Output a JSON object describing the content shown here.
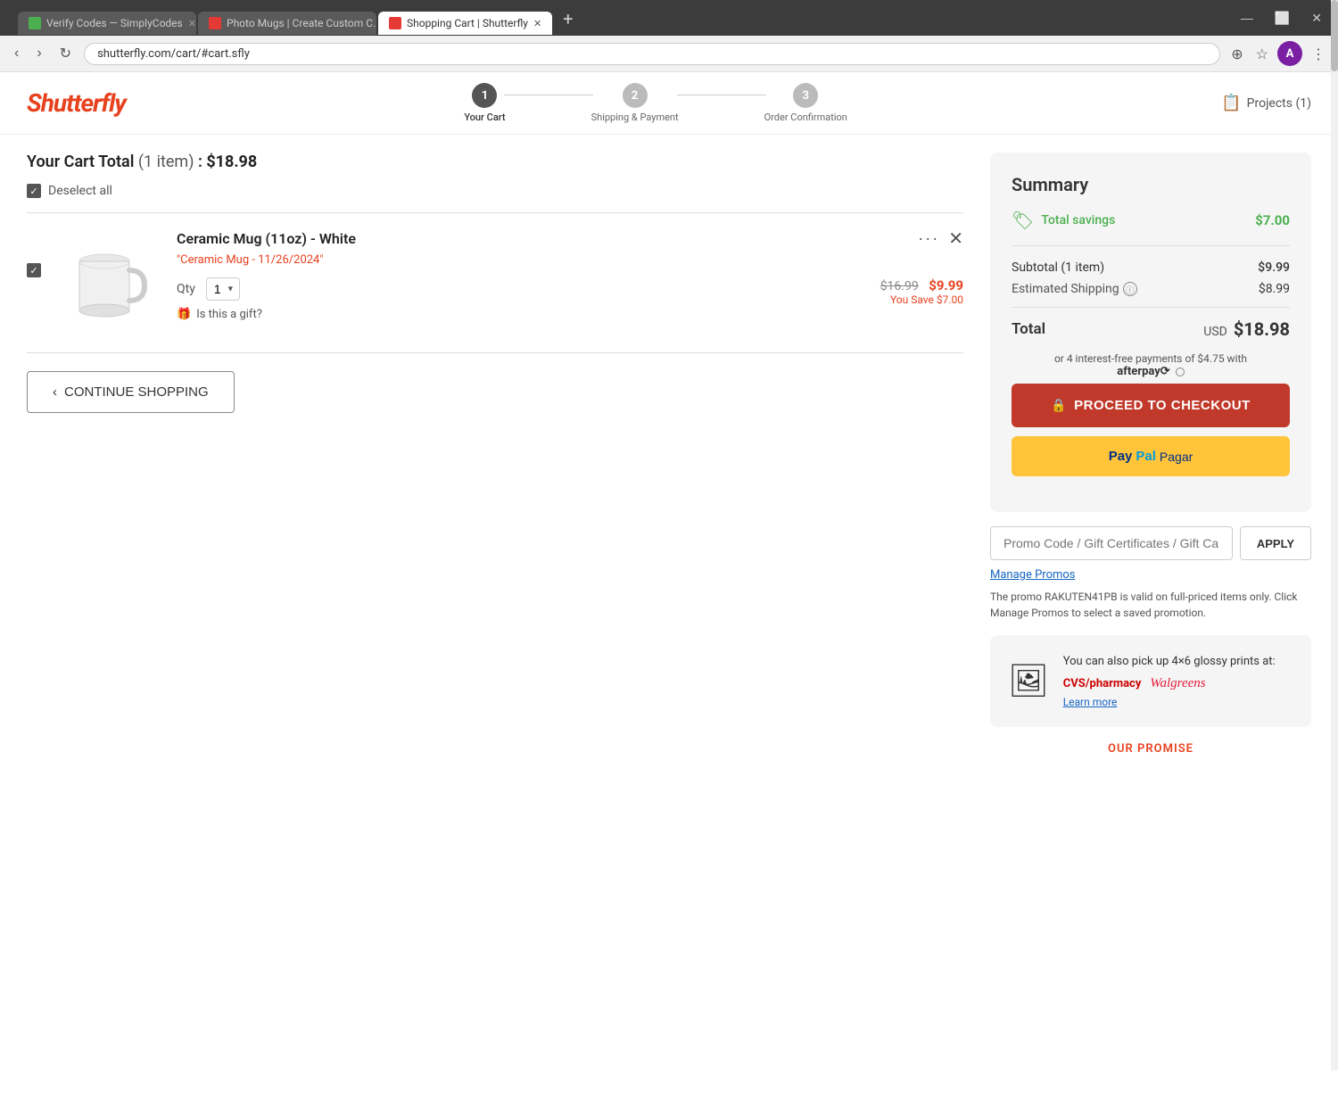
{
  "browser": {
    "tabs": [
      {
        "id": "tab1",
        "favicon_color": "green",
        "label": "Verify Codes — SimplyCodes",
        "active": false
      },
      {
        "id": "tab2",
        "favicon_color": "red",
        "label": "Photo Mugs | Create Custom C...",
        "active": false
      },
      {
        "id": "tab3",
        "favicon_color": "shutterfly",
        "label": "Shopping Cart | Shutterfly",
        "active": true
      }
    ],
    "add_tab_icon": "+",
    "nav": {
      "back": "‹",
      "forward": "›",
      "reload": "↻",
      "address": "shutterfly.com/cart/#cart.sfly"
    },
    "window_controls": {
      "minimize": "—",
      "maximize": "⬜",
      "close": "✕"
    }
  },
  "header": {
    "logo": "Shutterfly",
    "steps": [
      {
        "number": "1",
        "label": "Your Cart",
        "active": true
      },
      {
        "number": "2",
        "label": "Shipping & Payment",
        "active": false
      },
      {
        "number": "3",
        "label": "Order Confirmation",
        "active": false
      }
    ],
    "projects_label": "Projects (1)"
  },
  "cart": {
    "title": "Your Cart Total",
    "item_count": "(1 item)",
    "separator": ":",
    "total_display": "$18.98",
    "deselect_label": "Deselect all",
    "item": {
      "name": "Ceramic Mug (11oz) - White",
      "date": "\"Ceramic Mug - 11/26/2024\"",
      "qty_label": "Qty",
      "qty_value": "1",
      "original_price": "$16.99",
      "sale_price": "$9.99",
      "you_save": "You Save $7.00",
      "gift_label": "Is this a gift?"
    },
    "continue_btn": "CONTINUE SHOPPING",
    "continue_arrow": "‹"
  },
  "summary": {
    "title": "Summary",
    "total_savings_label": "Total savings",
    "total_savings_amount": "$7.00",
    "subtotal_label": "Subtotal (1 item)",
    "subtotal_amount": "$9.99",
    "shipping_label": "Estimated Shipping",
    "shipping_amount": "$8.99",
    "total_label": "Total",
    "total_currency": "USD",
    "total_amount": "$18.98",
    "afterpay_note": "or 4 interest-free payments of $4.75 with",
    "afterpay_brand": "afterpay⟳",
    "checkout_btn": "PROCEED TO CHECKOUT",
    "paypal_btn_blue": "PayPal",
    "paypal_btn_label": "Pagar",
    "promo_placeholder": "Promo Code / Gift Certificates / Gift Cards",
    "apply_btn": "APPLY",
    "manage_promos": "Manage Promos",
    "promo_note": "The promo RAKUTEN41PB is valid on full-priced items only. Click Manage Promos to select a saved promotion.",
    "pickup_text": "You can also pick up 4×6 glossy prints at:",
    "cvs_label": "CVS/pharmacy",
    "walgreens_label": "Walgreens",
    "learn_more": "Learn more",
    "promise_text": "OUR PROMISE"
  }
}
